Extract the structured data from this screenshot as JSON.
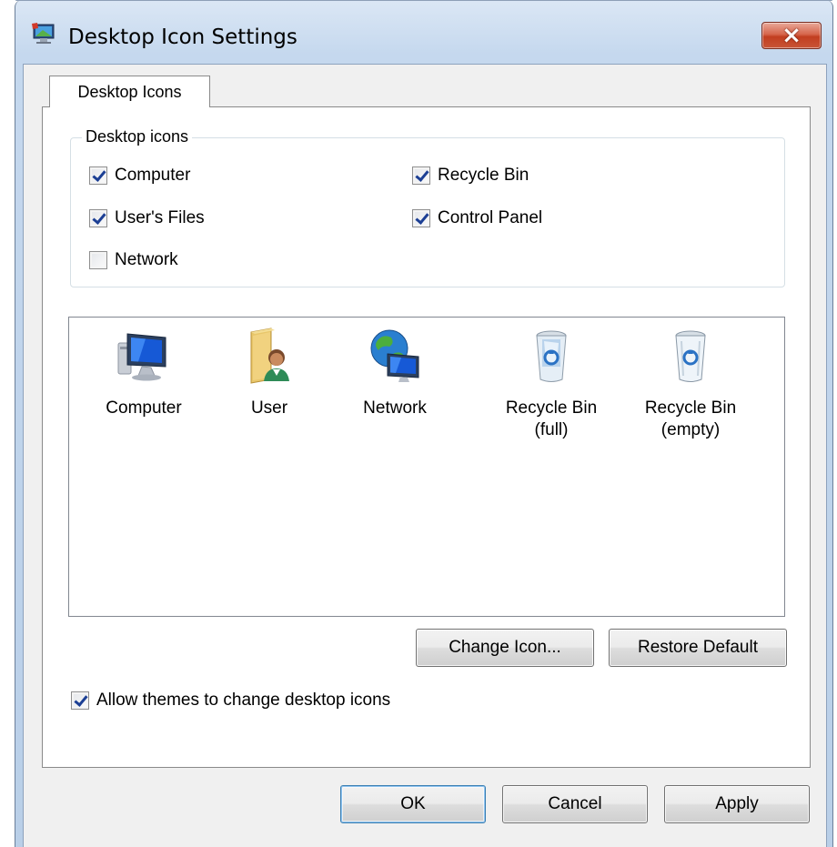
{
  "window": {
    "title": "Desktop Icon Settings",
    "close_glyph": "×"
  },
  "tabs": [
    {
      "label": "Desktop Icons",
      "selected": true
    }
  ],
  "desktop_icons_group": {
    "label": "Desktop icons",
    "checkboxes": {
      "computer": {
        "label": "Computer",
        "checked": true
      },
      "recycle_bin": {
        "label": "Recycle Bin",
        "checked": true
      },
      "users_files": {
        "label": "User's Files",
        "checked": true
      },
      "control_panel": {
        "label": "Control Panel",
        "checked": true
      },
      "network": {
        "label": "Network",
        "checked": false
      }
    }
  },
  "icon_list": [
    {
      "icon": "computer-icon",
      "label": "Computer"
    },
    {
      "icon": "user-folder-icon",
      "label": "User"
    },
    {
      "icon": "network-icon",
      "label": "Network"
    },
    {
      "icon": "recycle-bin-full-icon",
      "label": "Recycle Bin\n(full)"
    },
    {
      "icon": "recycle-bin-empty-icon",
      "label": "Recycle Bin\n(empty)"
    }
  ],
  "buttons": {
    "change_icon": "Change Icon...",
    "restore_default": "Restore Default",
    "ok": "OK",
    "cancel": "Cancel",
    "apply": "Apply"
  },
  "allow_themes": {
    "label": "Allow themes to change desktop icons",
    "checked": true
  },
  "colors": {
    "check_mark": "#1c3f94",
    "close_button": "#c85436",
    "title_bar": "#c5d8ee"
  }
}
